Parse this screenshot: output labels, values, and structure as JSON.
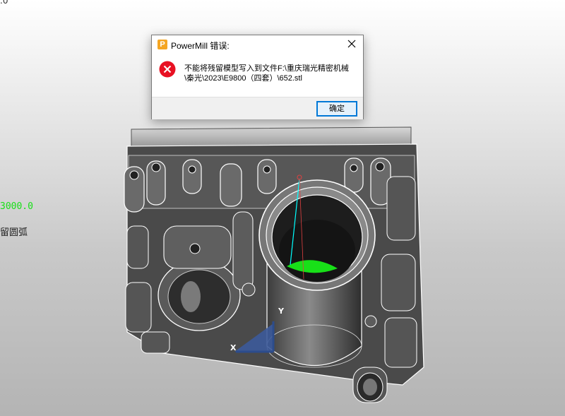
{
  "viewport": {
    "corner_value": ".0",
    "coord_value": "3000.0",
    "status_label": "留圆弧",
    "axis_x_label": "X",
    "axis_y_label": "Y"
  },
  "dialog": {
    "title": "PowerMill 错误:",
    "app_icon_letter": "P",
    "message": "不能将残留模型写入到文件F:\\重庆瑞光精密机械\\秦光\\2023\\E9800（四套）\\652.stl",
    "ok_label": "确定",
    "icons": {
      "app": "powermill-app-icon",
      "error": "error-icon",
      "close": "close-icon"
    }
  },
  "colors": {
    "error_red": "#e81123",
    "accent_blue": "#0078d7",
    "highlight_green": "#18e018",
    "app_orange": "#f5a623"
  }
}
